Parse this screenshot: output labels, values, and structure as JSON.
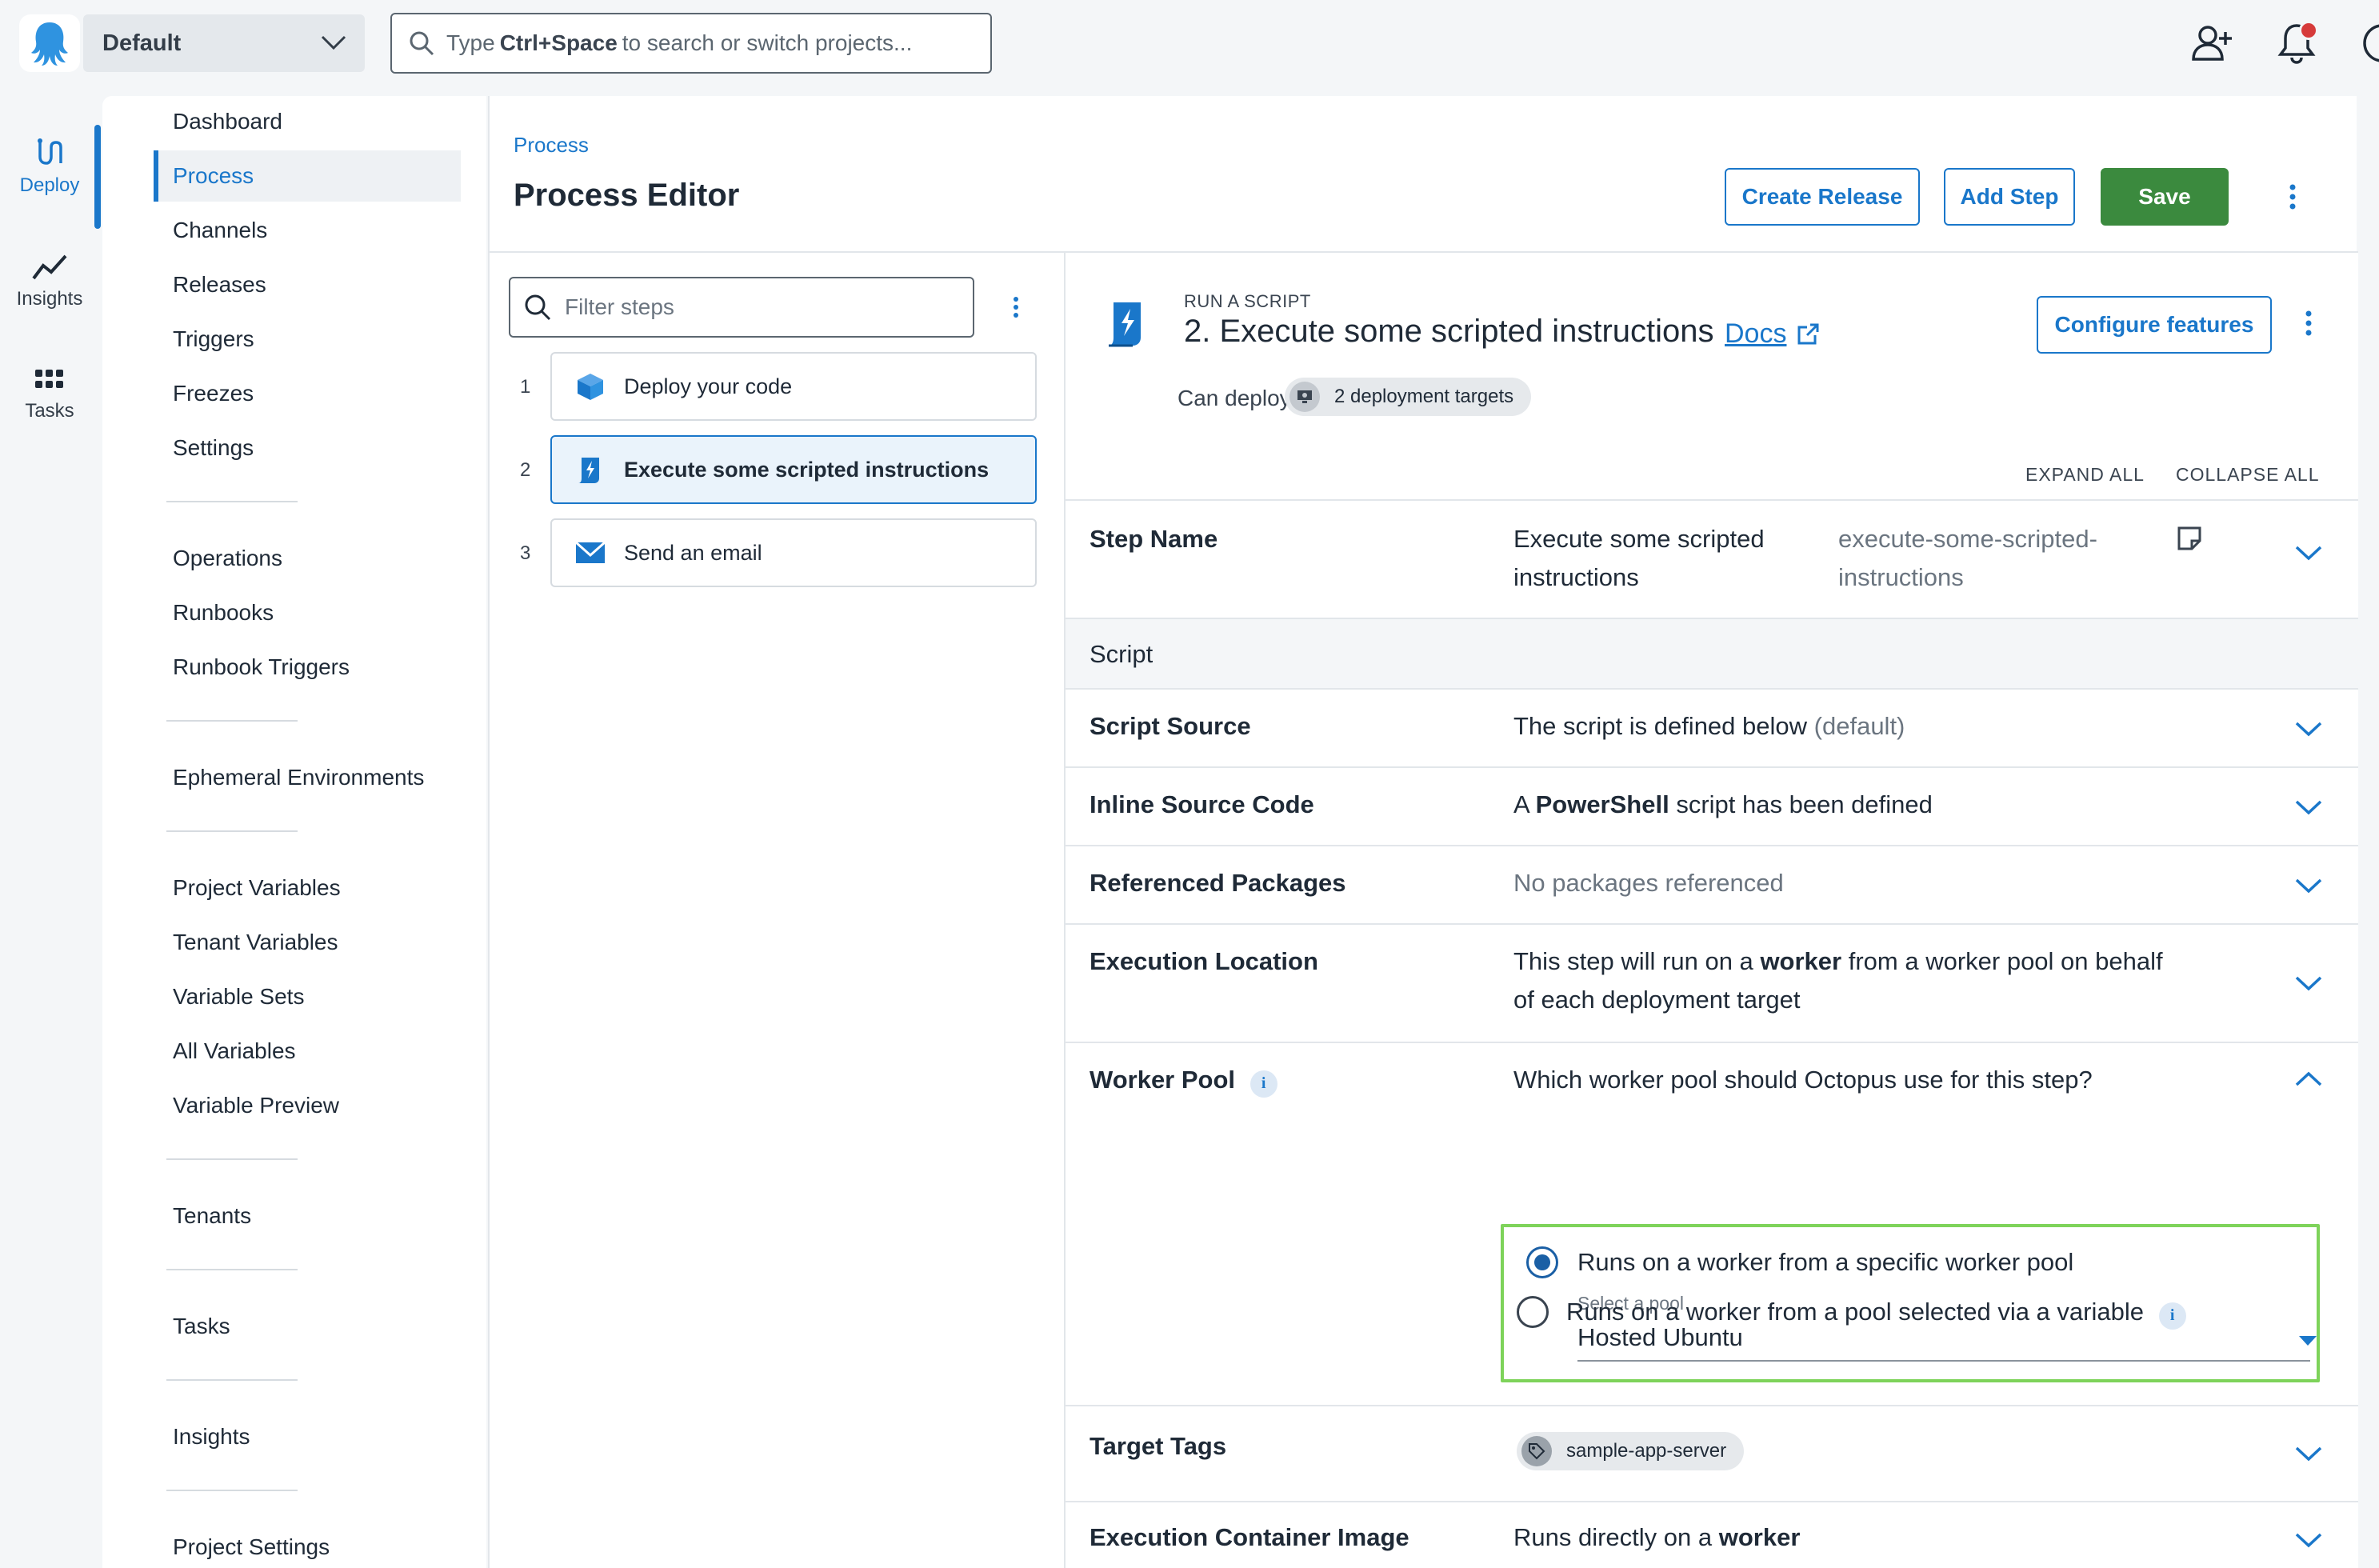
{
  "topbar": {
    "space_name": "Default",
    "search_prefix": "Type",
    "search_shortcut": "Ctrl+Space",
    "search_suffix": "to search or switch projects..."
  },
  "rail": {
    "items": [
      {
        "label": "Deploy",
        "icon": "deploy-icon"
      },
      {
        "label": "Insights",
        "icon": "insights-icon"
      },
      {
        "label": "Tasks",
        "icon": "tasks-icon"
      }
    ]
  },
  "project_nav": {
    "items": [
      "Dashboard",
      "Process",
      "Channels",
      "Releases",
      "Triggers",
      "Freezes",
      "Settings",
      "Operations",
      "Runbooks",
      "Runbook Triggers",
      "Ephemeral Environments",
      "Project Variables",
      "Tenant Variables",
      "Variable Sets",
      "All Variables",
      "Variable Preview",
      "Tenants",
      "Tasks",
      "Insights",
      "Project Settings"
    ],
    "active": "Process"
  },
  "header": {
    "breadcrumb": "Process",
    "title": "Process Editor",
    "create_release": "Create Release",
    "add_step": "Add Step",
    "save": "Save"
  },
  "steps_panel": {
    "filter_placeholder": "Filter steps",
    "steps": [
      {
        "number": "1",
        "name": "Deploy your code",
        "icon": "package-icon"
      },
      {
        "number": "2",
        "name": "Execute some scripted instructions",
        "icon": "script-icon"
      },
      {
        "number": "3",
        "name": "Send an email",
        "icon": "email-icon"
      }
    ]
  },
  "step_detail": {
    "type_label": "RUN A SCRIPT",
    "title": "2.  Execute some scripted instructions",
    "docs": "Docs",
    "configure_features": "Configure features",
    "can_deploy_to": "Can deploy to",
    "targets_chip": "2 deployment targets",
    "expand_all": "EXPAND ALL",
    "collapse_all": "COLLAPSE ALL",
    "step_name": {
      "label": "Step Name",
      "value_line1": "Execute some scripted",
      "value_line2": "instructions",
      "slug_line1": "execute-some-scripted-",
      "slug_line2": "instructions"
    },
    "section_script": "Script",
    "script_source": {
      "label": "Script Source",
      "value": "The script is defined below",
      "muted": "(default)"
    },
    "inline_source": {
      "label": "Inline Source Code",
      "prefix": "A",
      "bold": "PowerShell",
      "suffix": "script has been defined"
    },
    "referenced_packages": {
      "label": "Referenced Packages",
      "value": "No packages referenced"
    },
    "execution_location": {
      "label": "Execution Location",
      "prefix": "This step will run on a",
      "bold": "worker",
      "suffix": "from a worker pool on behalf",
      "line2": "of each deployment target"
    },
    "worker_pool": {
      "label": "Worker Pool",
      "question": "Which worker pool should Octopus use for this step?",
      "option1": "Runs on a worker from a specific worker pool",
      "select_label": "Select a pool",
      "select_value": "Hosted Ubuntu",
      "option2": "Runs on a worker from a pool selected via a variable",
      "selected_option": 1
    },
    "target_tags": {
      "label": "Target Tags",
      "tag": "sample-app-server"
    },
    "container_image": {
      "label": "Execution Container Image",
      "prefix": "Runs directly on a",
      "bold": "worker"
    }
  },
  "colors": {
    "accent": "#1a77ca",
    "save_green": "#3b8a3e",
    "highlight_box": "#7ed35a",
    "notification": "#d63a3a"
  }
}
